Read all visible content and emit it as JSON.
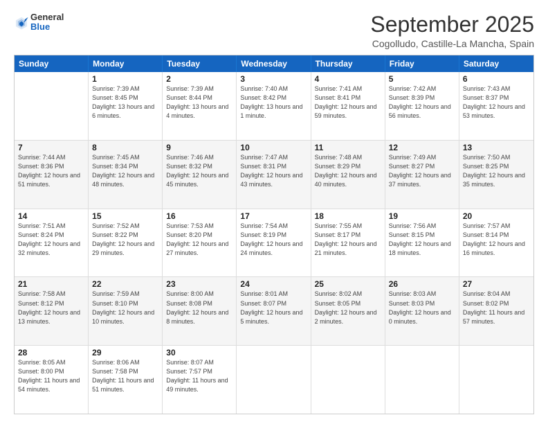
{
  "header": {
    "logo_general": "General",
    "logo_blue": "Blue",
    "month": "September 2025",
    "location": "Cogolludo, Castille-La Mancha, Spain"
  },
  "weekdays": [
    "Sunday",
    "Monday",
    "Tuesday",
    "Wednesday",
    "Thursday",
    "Friday",
    "Saturday"
  ],
  "rows": [
    [
      {
        "day": "",
        "sunrise": "",
        "sunset": "",
        "daylight": ""
      },
      {
        "day": "1",
        "sunrise": "Sunrise: 7:39 AM",
        "sunset": "Sunset: 8:45 PM",
        "daylight": "Daylight: 13 hours and 6 minutes."
      },
      {
        "day": "2",
        "sunrise": "Sunrise: 7:39 AM",
        "sunset": "Sunset: 8:44 PM",
        "daylight": "Daylight: 13 hours and 4 minutes."
      },
      {
        "day": "3",
        "sunrise": "Sunrise: 7:40 AM",
        "sunset": "Sunset: 8:42 PM",
        "daylight": "Daylight: 13 hours and 1 minute."
      },
      {
        "day": "4",
        "sunrise": "Sunrise: 7:41 AM",
        "sunset": "Sunset: 8:41 PM",
        "daylight": "Daylight: 12 hours and 59 minutes."
      },
      {
        "day": "5",
        "sunrise": "Sunrise: 7:42 AM",
        "sunset": "Sunset: 8:39 PM",
        "daylight": "Daylight: 12 hours and 56 minutes."
      },
      {
        "day": "6",
        "sunrise": "Sunrise: 7:43 AM",
        "sunset": "Sunset: 8:37 PM",
        "daylight": "Daylight: 12 hours and 53 minutes."
      }
    ],
    [
      {
        "day": "7",
        "sunrise": "Sunrise: 7:44 AM",
        "sunset": "Sunset: 8:36 PM",
        "daylight": "Daylight: 12 hours and 51 minutes."
      },
      {
        "day": "8",
        "sunrise": "Sunrise: 7:45 AM",
        "sunset": "Sunset: 8:34 PM",
        "daylight": "Daylight: 12 hours and 48 minutes."
      },
      {
        "day": "9",
        "sunrise": "Sunrise: 7:46 AM",
        "sunset": "Sunset: 8:32 PM",
        "daylight": "Daylight: 12 hours and 45 minutes."
      },
      {
        "day": "10",
        "sunrise": "Sunrise: 7:47 AM",
        "sunset": "Sunset: 8:31 PM",
        "daylight": "Daylight: 12 hours and 43 minutes."
      },
      {
        "day": "11",
        "sunrise": "Sunrise: 7:48 AM",
        "sunset": "Sunset: 8:29 PM",
        "daylight": "Daylight: 12 hours and 40 minutes."
      },
      {
        "day": "12",
        "sunrise": "Sunrise: 7:49 AM",
        "sunset": "Sunset: 8:27 PM",
        "daylight": "Daylight: 12 hours and 37 minutes."
      },
      {
        "day": "13",
        "sunrise": "Sunrise: 7:50 AM",
        "sunset": "Sunset: 8:25 PM",
        "daylight": "Daylight: 12 hours and 35 minutes."
      }
    ],
    [
      {
        "day": "14",
        "sunrise": "Sunrise: 7:51 AM",
        "sunset": "Sunset: 8:24 PM",
        "daylight": "Daylight: 12 hours and 32 minutes."
      },
      {
        "day": "15",
        "sunrise": "Sunrise: 7:52 AM",
        "sunset": "Sunset: 8:22 PM",
        "daylight": "Daylight: 12 hours and 29 minutes."
      },
      {
        "day": "16",
        "sunrise": "Sunrise: 7:53 AM",
        "sunset": "Sunset: 8:20 PM",
        "daylight": "Daylight: 12 hours and 27 minutes."
      },
      {
        "day": "17",
        "sunrise": "Sunrise: 7:54 AM",
        "sunset": "Sunset: 8:19 PM",
        "daylight": "Daylight: 12 hours and 24 minutes."
      },
      {
        "day": "18",
        "sunrise": "Sunrise: 7:55 AM",
        "sunset": "Sunset: 8:17 PM",
        "daylight": "Daylight: 12 hours and 21 minutes."
      },
      {
        "day": "19",
        "sunrise": "Sunrise: 7:56 AM",
        "sunset": "Sunset: 8:15 PM",
        "daylight": "Daylight: 12 hours and 18 minutes."
      },
      {
        "day": "20",
        "sunrise": "Sunrise: 7:57 AM",
        "sunset": "Sunset: 8:14 PM",
        "daylight": "Daylight: 12 hours and 16 minutes."
      }
    ],
    [
      {
        "day": "21",
        "sunrise": "Sunrise: 7:58 AM",
        "sunset": "Sunset: 8:12 PM",
        "daylight": "Daylight: 12 hours and 13 minutes."
      },
      {
        "day": "22",
        "sunrise": "Sunrise: 7:59 AM",
        "sunset": "Sunset: 8:10 PM",
        "daylight": "Daylight: 12 hours and 10 minutes."
      },
      {
        "day": "23",
        "sunrise": "Sunrise: 8:00 AM",
        "sunset": "Sunset: 8:08 PM",
        "daylight": "Daylight: 12 hours and 8 minutes."
      },
      {
        "day": "24",
        "sunrise": "Sunrise: 8:01 AM",
        "sunset": "Sunset: 8:07 PM",
        "daylight": "Daylight: 12 hours and 5 minutes."
      },
      {
        "day": "25",
        "sunrise": "Sunrise: 8:02 AM",
        "sunset": "Sunset: 8:05 PM",
        "daylight": "Daylight: 12 hours and 2 minutes."
      },
      {
        "day": "26",
        "sunrise": "Sunrise: 8:03 AM",
        "sunset": "Sunset: 8:03 PM",
        "daylight": "Daylight: 12 hours and 0 minutes."
      },
      {
        "day": "27",
        "sunrise": "Sunrise: 8:04 AM",
        "sunset": "Sunset: 8:02 PM",
        "daylight": "Daylight: 11 hours and 57 minutes."
      }
    ],
    [
      {
        "day": "28",
        "sunrise": "Sunrise: 8:05 AM",
        "sunset": "Sunset: 8:00 PM",
        "daylight": "Daylight: 11 hours and 54 minutes."
      },
      {
        "day": "29",
        "sunrise": "Sunrise: 8:06 AM",
        "sunset": "Sunset: 7:58 PM",
        "daylight": "Daylight: 11 hours and 51 minutes."
      },
      {
        "day": "30",
        "sunrise": "Sunrise: 8:07 AM",
        "sunset": "Sunset: 7:57 PM",
        "daylight": "Daylight: 11 hours and 49 minutes."
      },
      {
        "day": "",
        "sunrise": "",
        "sunset": "",
        "daylight": ""
      },
      {
        "day": "",
        "sunrise": "",
        "sunset": "",
        "daylight": ""
      },
      {
        "day": "",
        "sunrise": "",
        "sunset": "",
        "daylight": ""
      },
      {
        "day": "",
        "sunrise": "",
        "sunset": "",
        "daylight": ""
      }
    ]
  ]
}
